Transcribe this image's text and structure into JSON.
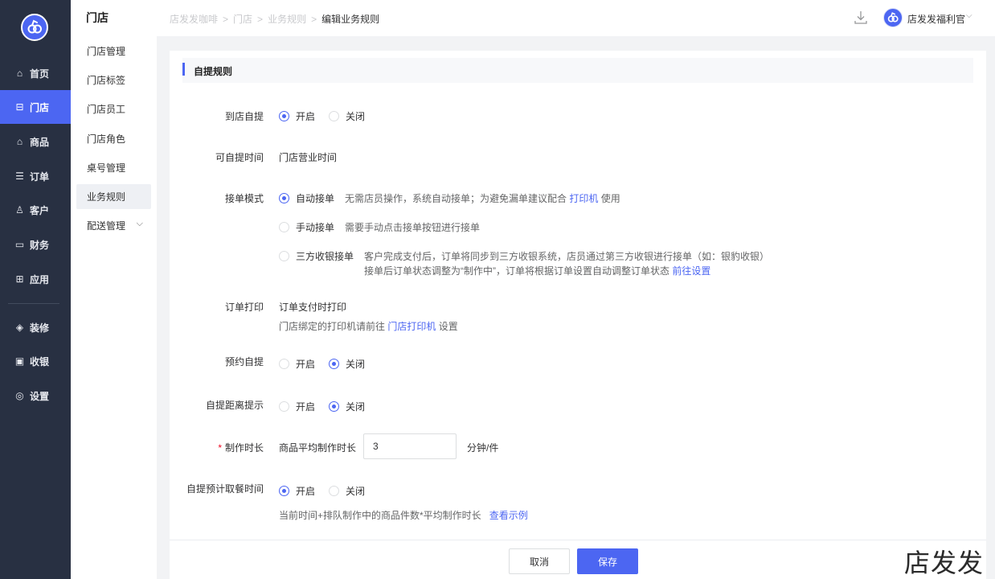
{
  "nav": {
    "items": [
      {
        "label": "首页",
        "icon": "home-icon"
      },
      {
        "label": "门店",
        "icon": "store-icon"
      },
      {
        "label": "商品",
        "icon": "goods-icon"
      },
      {
        "label": "订单",
        "icon": "order-icon"
      },
      {
        "label": "客户",
        "icon": "customer-icon"
      },
      {
        "label": "财务",
        "icon": "finance-icon"
      },
      {
        "label": "应用",
        "icon": "apps-icon"
      },
      {
        "label": "装修",
        "icon": "decoration-icon"
      },
      {
        "label": "收银",
        "icon": "cashier-icon"
      },
      {
        "label": "设置",
        "icon": "settings-icon"
      }
    ],
    "active": "门店",
    "accent": "#4c66f2"
  },
  "subnav": {
    "title": "门店",
    "items": [
      "门店管理",
      "门店标签",
      "门店员工",
      "门店角色",
      "桌号管理",
      "业务规则",
      "配送管理"
    ],
    "active": "业务规则"
  },
  "header": {
    "breadcrumb": [
      "店发发咖啡",
      "门店",
      "业务规则",
      "编辑业务规则"
    ],
    "sep": ">",
    "user_name": "店发发福利官"
  },
  "section": {
    "title": "自提规则"
  },
  "form": {
    "store_pickup": {
      "label": "到店自提",
      "options": [
        "开启",
        "关闭"
      ],
      "selected": "开启"
    },
    "pickup_time": {
      "label": "可自提时间",
      "value": "门店营业时间"
    },
    "accept_mode": {
      "label": "接单模式",
      "options": [
        {
          "label": "自动接单",
          "desc_prefix": "无需店员操作，系统自动接单；为避免漏单建议配合",
          "desc_link": "打印机",
          "desc_suffix": "使用"
        },
        {
          "label": "手动接单",
          "desc": "需要手动点击接单按钮进行接单"
        },
        {
          "label": "三方收银接单",
          "desc_line1": "客户完成支付后，订单将同步到三方收银系统，店员通过第三方收银进行接单（如：银豹收银）",
          "desc_line2_prefix": "接单后订单状态调整为“制作中”，订单将根据订单设置自动调整订单状态",
          "desc_link": "前往设置"
        }
      ],
      "selected": "自动接单"
    },
    "order_print": {
      "label": "订单打印",
      "value": "订单支付时打印",
      "hint_prefix": "门店绑定的打印机请前往",
      "hint_link": "门店打印机",
      "hint_suffix": "设置"
    },
    "reserve_pickup": {
      "label": "预约自提",
      "options": [
        "开启",
        "关闭"
      ],
      "selected": "关闭"
    },
    "distance_hint": {
      "label": "自提距离提示",
      "options": [
        "开启",
        "关闭"
      ],
      "selected": "关闭"
    },
    "make_time": {
      "label": "制作时长",
      "prefix": "商品平均制作时长",
      "value": "3",
      "unit": "分钟/件"
    },
    "est_time": {
      "label": "自提预计取餐时间",
      "options": [
        "开启",
        "关闭"
      ],
      "selected": "开启",
      "hint": "当前时间+排队制作中的商品件数*平均制作时长",
      "hint_link": "查看示例"
    }
  },
  "footer": {
    "cancel": "取消",
    "save": "保存"
  },
  "watermark": "店发发"
}
